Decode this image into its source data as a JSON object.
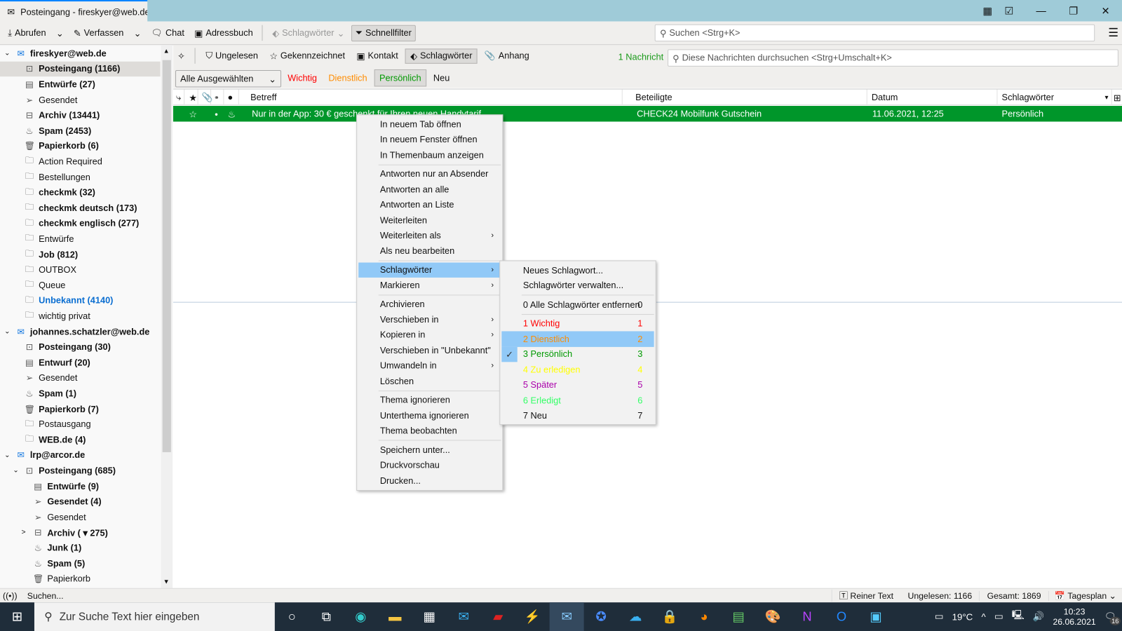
{
  "window": {
    "tab_title": "Posteingang - fireskyer@web.de"
  },
  "toolbar": {
    "get": "Abrufen",
    "write": "Verfassen",
    "chat": "Chat",
    "addressbook": "Adressbuch",
    "tags": "Schlagwörter",
    "quickfilter": "Schnellfilter",
    "search_placeholder": "Suchen <Strg+K>"
  },
  "folders": [
    {
      "label": "fireskyer@web.de",
      "level": 0,
      "type": "account",
      "bold": true,
      "twisty": "v"
    },
    {
      "label": "Posteingang (1166)",
      "level": 1,
      "type": "inbox",
      "bold": true,
      "selected": true
    },
    {
      "label": "Entwürfe (27)",
      "level": 1,
      "type": "drafts",
      "bold": true
    },
    {
      "label": "Gesendet",
      "level": 1,
      "type": "sent"
    },
    {
      "label": "Archiv (13441)",
      "level": 1,
      "type": "archive",
      "bold": true
    },
    {
      "label": "Spam (2453)",
      "level": 1,
      "type": "spam",
      "bold": true
    },
    {
      "label": "Papierkorb (6)",
      "level": 1,
      "type": "trash",
      "bold": true
    },
    {
      "label": "Action Required",
      "level": 1,
      "type": "folder"
    },
    {
      "label": "Bestellungen",
      "level": 1,
      "type": "folder"
    },
    {
      "label": "checkmk (32)",
      "level": 1,
      "type": "folder",
      "bold": true
    },
    {
      "label": "checkmk deutsch  (173)",
      "level": 1,
      "type": "folder",
      "bold": true
    },
    {
      "label": "checkmk englisch  (277)",
      "level": 1,
      "type": "folder",
      "bold": true
    },
    {
      "label": "Entwürfe",
      "level": 1,
      "type": "folder"
    },
    {
      "label": "Job (812)",
      "level": 1,
      "type": "folder",
      "bold": true
    },
    {
      "label": "OUTBOX",
      "level": 1,
      "type": "folder"
    },
    {
      "label": "Queue",
      "level": 1,
      "type": "folder"
    },
    {
      "label": "Unbekannt (4140)",
      "level": 1,
      "type": "folder",
      "bold": true,
      "blue": true
    },
    {
      "label": "wichtig privat",
      "level": 1,
      "type": "folder"
    },
    {
      "label": "johannes.schatzler@web.de",
      "level": 0,
      "type": "account",
      "bold": true,
      "twisty": "v"
    },
    {
      "label": "Posteingang (30)",
      "level": 1,
      "type": "inbox",
      "bold": true
    },
    {
      "label": "Entwurf (20)",
      "level": 1,
      "type": "drafts",
      "bold": true
    },
    {
      "label": "Gesendet",
      "level": 1,
      "type": "sent"
    },
    {
      "label": "Spam (1)",
      "level": 1,
      "type": "spam",
      "bold": true
    },
    {
      "label": "Papierkorb (7)",
      "level": 1,
      "type": "trash",
      "bold": true
    },
    {
      "label": "Postausgang",
      "level": 1,
      "type": "folder"
    },
    {
      "label": "WEB.de (4)",
      "level": 1,
      "type": "folder",
      "bold": true
    },
    {
      "label": "lrp@arcor.de",
      "level": 0,
      "type": "account",
      "bold": true,
      "twisty": "v"
    },
    {
      "label": "Posteingang (685)",
      "level": 1,
      "type": "inbox",
      "bold": true,
      "twisty": "v"
    },
    {
      "label": "Entwürfe (9)",
      "level": 2,
      "type": "drafts",
      "bold": true
    },
    {
      "label": "Gesendet (4)",
      "level": 2,
      "type": "sent",
      "bold": true
    },
    {
      "label": "Gesendet",
      "level": 2,
      "type": "sent"
    },
    {
      "label": "Archiv ( ▾ 275)",
      "level": 2,
      "type": "archive",
      "bold": true,
      "twisty": ">"
    },
    {
      "label": "Junk (1)",
      "level": 2,
      "type": "spam",
      "bold": true
    },
    {
      "label": "Spam (5)",
      "level": 2,
      "type": "spam",
      "bold": true
    },
    {
      "label": "Papierkorb",
      "level": 2,
      "type": "trash"
    }
  ],
  "quickfilter": {
    "unread": "Ungelesen",
    "starred": "Gekennzeichnet",
    "contact": "Kontakt",
    "tags": "Schlagwörter",
    "attachment": "Anhang",
    "count": "1 Nachricht",
    "search_placeholder": "Diese Nachrichten durchsuchen <Strg+Umschalt+K>",
    "tag_mode": "Alle Ausgewählten",
    "tag_buttons": [
      {
        "label": "Wichtig",
        "color": "#ff0000"
      },
      {
        "label": "Dienstlich",
        "color": "#ff8c00"
      },
      {
        "label": "Persönlich",
        "color": "#009900",
        "pressed": true
      },
      {
        "label": "Neu",
        "color": "#111111"
      }
    ]
  },
  "columns": {
    "subject": "Betreff",
    "correspondents": "Beteiligte",
    "date": "Datum",
    "tags": "Schlagwörter"
  },
  "message": {
    "subject": "Nur in der App: 30 € geschenkt für Ihren neuen Handytarif",
    "correspondent": "CHECK24 Mobilfunk Gutschein",
    "date": "11.06.2021, 12:25",
    "tags": "Persönlich",
    "color": "#00962a"
  },
  "context_menu": [
    {
      "label": "In neuem Tab öffnen"
    },
    {
      "label": "In neuem Fenster öffnen"
    },
    {
      "label": "In Themenbaum anzeigen"
    },
    {
      "sep": true
    },
    {
      "label": "Antworten nur an Absender"
    },
    {
      "label": "Antworten an alle"
    },
    {
      "label": "Antworten an Liste"
    },
    {
      "label": "Weiterleiten"
    },
    {
      "label": "Weiterleiten als",
      "sub": true
    },
    {
      "label": "Als neu bearbeiten"
    },
    {
      "sep": true
    },
    {
      "label": "Schlagwörter",
      "sub": true,
      "hl": true
    },
    {
      "label": "Markieren",
      "sub": true
    },
    {
      "sep": true
    },
    {
      "label": "Archivieren"
    },
    {
      "label": "Verschieben in",
      "sub": true
    },
    {
      "label": "Kopieren in",
      "sub": true
    },
    {
      "label": "Verschieben in \"Unbekannt\""
    },
    {
      "label": "Umwandeln in",
      "sub": true
    },
    {
      "label": "Löschen"
    },
    {
      "sep": true
    },
    {
      "label": "Thema ignorieren"
    },
    {
      "label": "Unterthema ignorieren"
    },
    {
      "label": "Thema beobachten"
    },
    {
      "sep": true
    },
    {
      "label": "Speichern unter..."
    },
    {
      "label": "Druckvorschau"
    },
    {
      "label": "Drucken..."
    }
  ],
  "tags_submenu": [
    {
      "label": "Neues Schlagwort..."
    },
    {
      "label": "Schlagwörter verwalten..."
    },
    {
      "sep": true
    },
    {
      "label": "0 Alle Schlagwörter entfernen",
      "key": "0",
      "color": "#111111"
    },
    {
      "sep": true
    },
    {
      "label": "1 Wichtig",
      "key": "1",
      "color": "#ff0000"
    },
    {
      "label": "2 Dienstlich",
      "key": "2",
      "color": "#ff8c00",
      "hl": true
    },
    {
      "label": "3 Persönlich",
      "key": "3",
      "color": "#009900",
      "checked": true
    },
    {
      "label": "4 Zu erledigen",
      "key": "4",
      "color": "#ffff00"
    },
    {
      "label": "5 Später",
      "key": "5",
      "color": "#aa00aa"
    },
    {
      "label": "6 Erledigt",
      "key": "6",
      "color": "#33ff66"
    },
    {
      "label": "7 Neu",
      "key": "7",
      "color": "#111111"
    }
  ],
  "statusbar": {
    "activity": "Suchen...",
    "format": "Reiner Text",
    "unread": "Ungelesen: 1166",
    "total": "Gesamt: 1869",
    "today": "Tagesplan"
  },
  "taskbar": {
    "search_placeholder": "Zur Suche Text hier eingeben",
    "weather": "19°C",
    "time": "10:23",
    "date": "26.06.2021",
    "notifications": "16"
  }
}
